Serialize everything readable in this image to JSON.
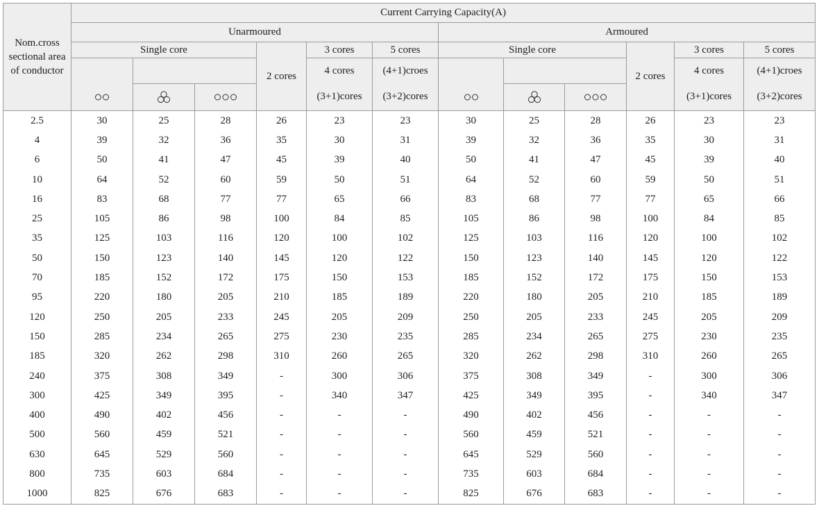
{
  "header": {
    "conductor": [
      "Nom.cross",
      "sectional area",
      "of conductor"
    ],
    "capacity": "Current Carrying Capacity(A)",
    "unarmoured": "Unarmoured",
    "armoured": "Armoured",
    "single_core": "Single core",
    "two_cores": "2 cores",
    "three_cores": "3 cores",
    "five_cores": "5 cores",
    "four_cores": "4 cores",
    "four_plus_one": "(4+1)croes",
    "three_plus_one": "(3+1)cores",
    "three_plus_two": "(3+2)cores",
    "layout_icons": [
      "two-circles-flat-icon",
      "three-circles-trefoil-icon",
      "three-circles-flat-icon"
    ]
  },
  "rows": [
    [
      "2.5",
      "30",
      "25",
      "28",
      "26",
      "23",
      "23",
      "30",
      "25",
      "28",
      "26",
      "23",
      "23"
    ],
    [
      "4",
      "39",
      "32",
      "36",
      "35",
      "30",
      "31",
      "39",
      "32",
      "36",
      "35",
      "30",
      "31"
    ],
    [
      "6",
      "50",
      "41",
      "47",
      "45",
      "39",
      "40",
      "50",
      "41",
      "47",
      "45",
      "39",
      "40"
    ],
    [
      "10",
      "64",
      "52",
      "60",
      "59",
      "50",
      "51",
      "64",
      "52",
      "60",
      "59",
      "50",
      "51"
    ],
    [
      "16",
      "83",
      "68",
      "77",
      "77",
      "65",
      "66",
      "83",
      "68",
      "77",
      "77",
      "65",
      "66"
    ],
    [
      "25",
      "105",
      "86",
      "98",
      "100",
      "84",
      "85",
      "105",
      "86",
      "98",
      "100",
      "84",
      "85"
    ],
    [
      "35",
      "125",
      "103",
      "116",
      "120",
      "100",
      "102",
      "125",
      "103",
      "116",
      "120",
      "100",
      "102"
    ],
    [
      "50",
      "150",
      "123",
      "140",
      "145",
      "120",
      "122",
      "150",
      "123",
      "140",
      "145",
      "120",
      "122"
    ],
    [
      "70",
      "185",
      "152",
      "172",
      "175",
      "150",
      "153",
      "185",
      "152",
      "172",
      "175",
      "150",
      "153"
    ],
    [
      "95",
      "220",
      "180",
      "205",
      "210",
      "185",
      "189",
      "220",
      "180",
      "205",
      "210",
      "185",
      "189"
    ],
    [
      "120",
      "250",
      "205",
      "233",
      "245",
      "205",
      "209",
      "250",
      "205",
      "233",
      "245",
      "205",
      "209"
    ],
    [
      "150",
      "285",
      "234",
      "265",
      "275",
      "230",
      "235",
      "285",
      "234",
      "265",
      "275",
      "230",
      "235"
    ],
    [
      "185",
      "320",
      "262",
      "298",
      "310",
      "260",
      "265",
      "320",
      "262",
      "298",
      "310",
      "260",
      "265"
    ],
    [
      "240",
      "375",
      "308",
      "349",
      "-",
      "300",
      "306",
      "375",
      "308",
      "349",
      "-",
      "300",
      "306"
    ],
    [
      "300",
      "425",
      "349",
      "395",
      "-",
      "340",
      "347",
      "425",
      "349",
      "395",
      "-",
      "340",
      "347"
    ],
    [
      "400",
      "490",
      "402",
      "456",
      "-",
      "-",
      "-",
      "490",
      "402",
      "456",
      "-",
      "-",
      "-"
    ],
    [
      "500",
      "560",
      "459",
      "521",
      "-",
      "-",
      "-",
      "560",
      "459",
      "521",
      "-",
      "-",
      "-"
    ],
    [
      "630",
      "645",
      "529",
      "560",
      "-",
      "-",
      "-",
      "645",
      "529",
      "560",
      "-",
      "-",
      "-"
    ],
    [
      "800",
      "735",
      "603",
      "684",
      "-",
      "-",
      "-",
      "735",
      "603",
      "684",
      "-",
      "-",
      "-"
    ],
    [
      "1000",
      "825",
      "676",
      "683",
      "-",
      "-",
      "-",
      "825",
      "676",
      "683",
      "-",
      "-",
      "-"
    ]
  ]
}
